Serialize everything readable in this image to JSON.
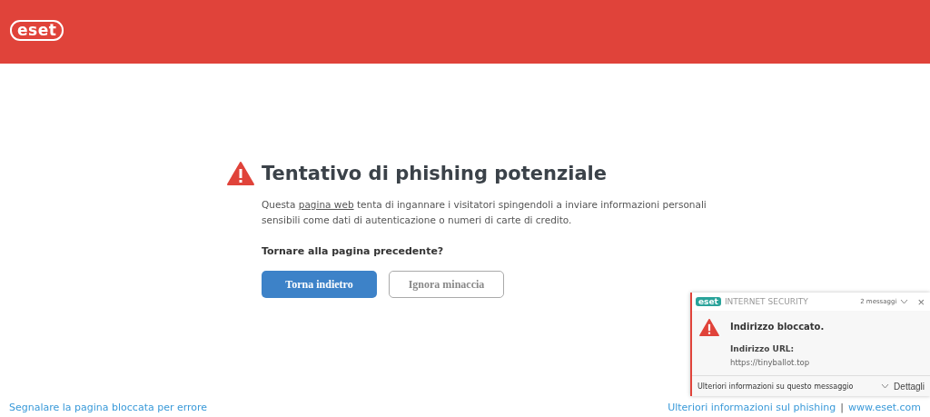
{
  "header": {
    "logo": "eset"
  },
  "warning": {
    "title": "Tentativo di phishing potenziale",
    "text_before": "Questa ",
    "link": "pagina web",
    "text_after": " tenta di ingannare i visitatori spingendoli a inviare informazioni personali sensibili come dati di autenticazione o numeri di carte di credito.",
    "question": "Tornare alla pagina precedente?",
    "buttons": [
      {
        "label": "Torna indietro",
        "kind": "primary"
      },
      {
        "label": "Ignora minaccia",
        "kind": "secondary"
      }
    ]
  },
  "footer": {
    "report_link": "Segnalare la pagina bloccata per errore",
    "links": [
      "Ulteriori informazioni sul phishing",
      "www.eset.com"
    ],
    "separator": "|"
  },
  "notification": {
    "logo": "eset",
    "product": "INTERNET SECURITY",
    "count": "2 messaggi",
    "close": "×",
    "title": "Indirizzo bloccato.",
    "field_label": "Indirizzo URL:",
    "field_value": "https://tinyballot.top",
    "more_info": "Ulteriori informazioni su questo messaggio",
    "details": "Dettagli"
  }
}
